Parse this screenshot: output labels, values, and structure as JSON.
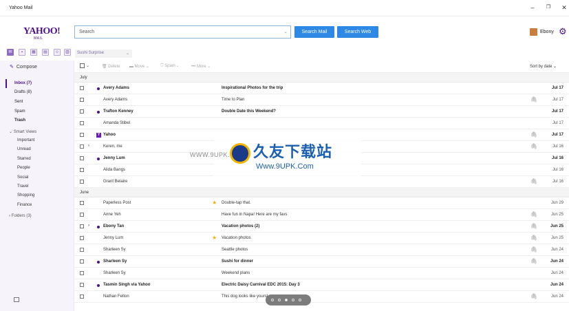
{
  "window": {
    "title": "Yahoo Mail",
    "min": "–",
    "max": "❐",
    "close": "✕"
  },
  "header": {
    "logo": "YAHOO!",
    "logo_sub": "MAIL",
    "search_placeholder": "Search",
    "search_mail": "Search Mail",
    "search_web": "Search Web",
    "user_name": "Ebony"
  },
  "appbar": {
    "selector_text": "Sushi Surprise"
  },
  "sidebar": {
    "compose": "Compose",
    "folders": [
      {
        "label": "Inbox (7)",
        "selected": true
      },
      {
        "label": "Drafts (8)"
      },
      {
        "label": "Sent"
      },
      {
        "label": "Spam"
      },
      {
        "label": "Trash",
        "bold": true
      }
    ],
    "smart_views": "Smart Views",
    "smart_items": [
      "Important",
      "Unread",
      "Starred",
      "People",
      "Social",
      "Travel",
      "Shopping",
      "Finance"
    ],
    "folders_section": "Folders (3)"
  },
  "toolbar": {
    "delete": "Delete",
    "move": "Move",
    "spam": "Spam",
    "more": "More",
    "sort": "Sort by date"
  },
  "groups": [
    "July",
    "June"
  ],
  "messages": [
    {
      "from": "Avery Adams",
      "subject": "Inspirational Photos for the trip",
      "date": "Jul 17",
      "unread": true,
      "attach": false,
      "star": false,
      "thread": false,
      "yahoo": false
    },
    {
      "from": "Avery Adams",
      "subject": "Time to Plan",
      "date": "Jul 17",
      "unread": false,
      "attach": true,
      "star": false,
      "thread": false,
      "yahoo": false
    },
    {
      "from": "Trafton Kenney",
      "subject": "Double Date this Weekend?",
      "date": "Jul 17",
      "unread": true,
      "attach": false,
      "star": false,
      "thread": false,
      "yahoo": false
    },
    {
      "from": "Amanda Stibel",
      "subject": "",
      "date": "Jul 17",
      "unread": false,
      "attach": false,
      "star": false,
      "thread": false,
      "yahoo": false
    },
    {
      "from": "Yahoo",
      "subject": "",
      "date": "Jul 17",
      "unread": true,
      "attach": true,
      "star": false,
      "thread": false,
      "yahoo": true
    },
    {
      "from": "Keren, me",
      "subject": "",
      "date": "Jul 16",
      "unread": false,
      "attach": true,
      "star": false,
      "thread": true,
      "yahoo": false
    },
    {
      "from": "Jenny Lum",
      "subject": "",
      "date": "Jul 16",
      "unread": true,
      "attach": false,
      "star": false,
      "thread": false,
      "yahoo": false
    },
    {
      "from": "Alida Bangs",
      "subject": "",
      "date": "Jul 16",
      "unread": false,
      "attach": false,
      "star": false,
      "thread": false,
      "yahoo": false
    },
    {
      "from": "Grant Belaire",
      "subject": "",
      "date": "Jul 16",
      "unread": false,
      "attach": true,
      "star": false,
      "thread": false,
      "yahoo": false
    },
    {
      "from": "Paperless Post",
      "subject": "Double-tap that.",
      "date": "Jun 29",
      "unread": false,
      "attach": false,
      "star": true,
      "thread": false,
      "yahoo": false
    },
    {
      "from": "Anne Yeh",
      "subject": "Have fun in Napa! Here are my favs",
      "date": "Jun 25",
      "unread": false,
      "attach": true,
      "star": false,
      "thread": false,
      "yahoo": false
    },
    {
      "from": "Ebony Tan",
      "subject": "Vacation photos (2)",
      "date": "Jun 25",
      "unread": true,
      "attach": true,
      "star": false,
      "thread": true,
      "yahoo": false
    },
    {
      "from": "Jenny Lum",
      "subject": "Vacation photos",
      "date": "Jun 25",
      "unread": false,
      "attach": true,
      "star": true,
      "thread": false,
      "yahoo": false
    },
    {
      "from": "Sharleen Sy",
      "subject": "Seattle photos",
      "date": "Jun 24",
      "unread": false,
      "attach": true,
      "star": false,
      "thread": false,
      "yahoo": false
    },
    {
      "from": "Sharleen Sy",
      "subject": "Sushi for dinner",
      "date": "Jun 24",
      "unread": true,
      "attach": true,
      "star": false,
      "thread": false,
      "yahoo": false
    },
    {
      "from": "Sharleen Sy",
      "subject": "Weekend plans",
      "date": "Jun 24",
      "unread": false,
      "attach": false,
      "star": false,
      "thread": false,
      "yahoo": false
    },
    {
      "from": "Tasmin Singh via Yahoo",
      "subject": "Electric Daisy Carnival EDC 2015: Day 3",
      "date": "Jun 24",
      "unread": true,
      "attach": false,
      "star": false,
      "thread": false,
      "yahoo": false
    },
    {
      "from": "Nathan Felton",
      "subject": "This dog looks like yours!",
      "date": "Jun 24",
      "unread": false,
      "attach": true,
      "star": false,
      "thread": false,
      "yahoo": false
    }
  ],
  "watermark": {
    "url": "WWW.9UPK.COM",
    "cn": "久友下载站",
    "sub": "Www.9UPK.Com"
  }
}
